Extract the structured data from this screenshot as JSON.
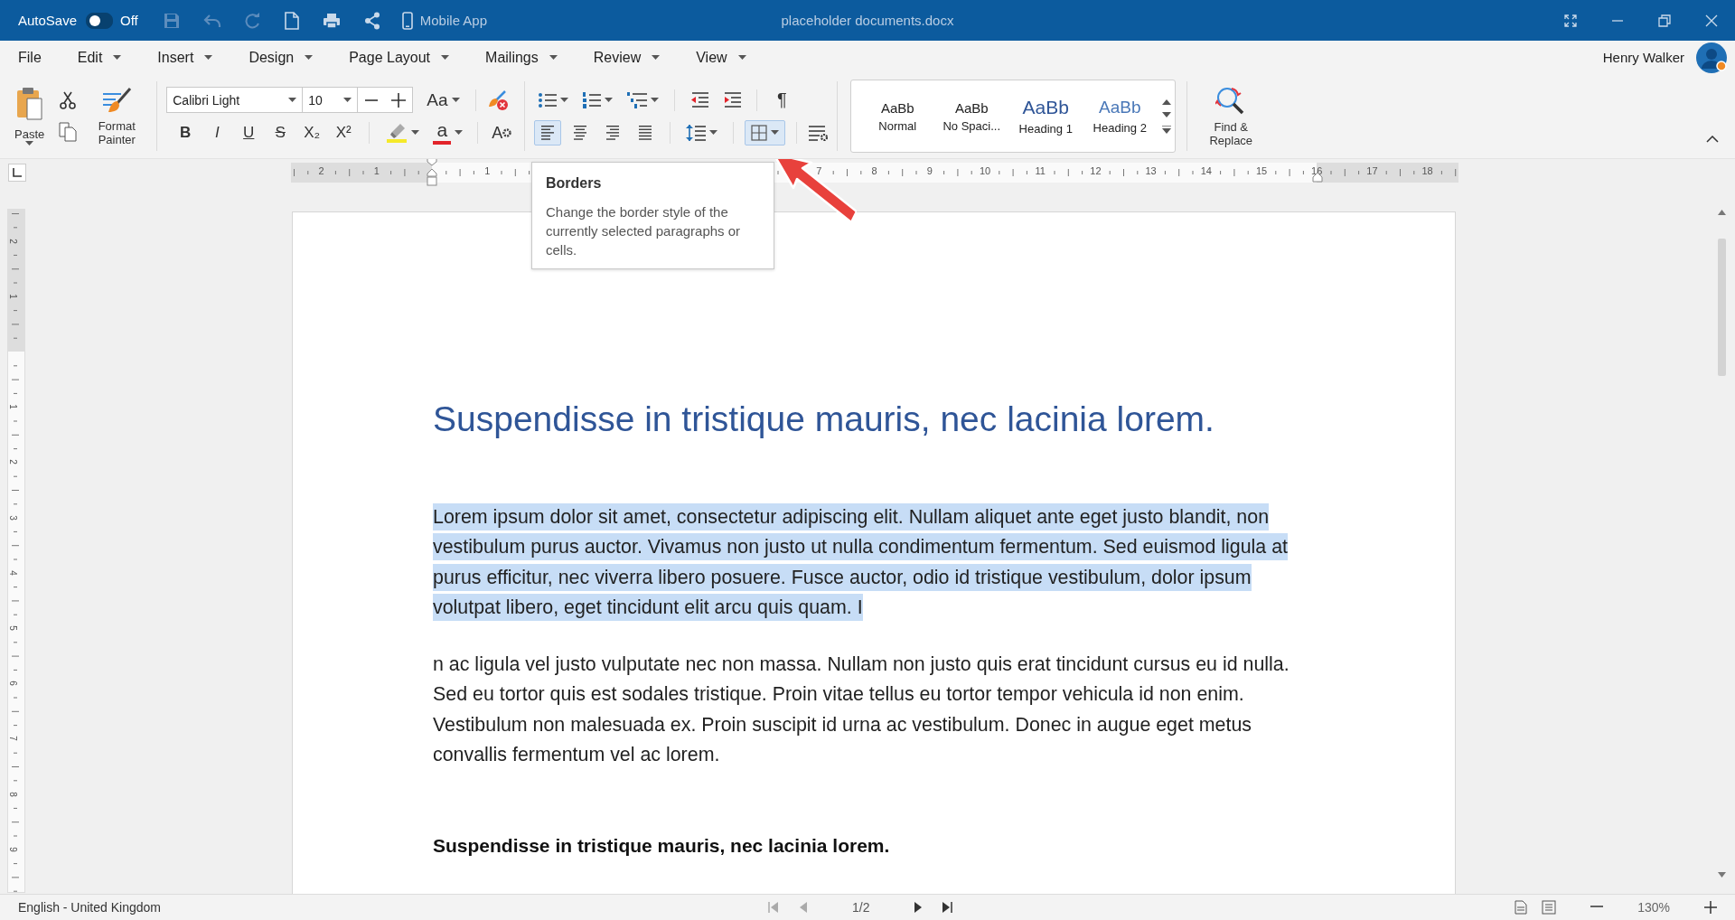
{
  "title_bar": {
    "autosave_label": "AutoSave",
    "autosave": {
      "on": false,
      "label": "Off"
    },
    "mobile_app": "Mobile App",
    "title": "placeholder documents.docx"
  },
  "menu": [
    {
      "label": "File",
      "has_menu": false
    },
    {
      "label": "Edit",
      "has_menu": true
    },
    {
      "label": "Insert",
      "has_menu": true
    },
    {
      "label": "Design",
      "has_menu": true
    },
    {
      "label": "Page Layout",
      "has_menu": true
    },
    {
      "label": "Mailings",
      "has_menu": true
    },
    {
      "label": "Review",
      "has_menu": true
    },
    {
      "label": "View",
      "has_menu": true
    }
  ],
  "user": {
    "name": "Henry Walker"
  },
  "ribbon": {
    "paste": "Paste",
    "format_painter": "Format Painter",
    "font_name": "Calibri Light",
    "font_size": "10",
    "case_label": "Aa",
    "font_color_label": "a",
    "effects_label": "A",
    "pilcrow": "¶",
    "format_buttons": [
      {
        "kind": "bold",
        "label": "B"
      },
      {
        "kind": "italic",
        "label": "I"
      },
      {
        "kind": "underline",
        "label": "U"
      },
      {
        "kind": "strike",
        "label": "S"
      },
      {
        "kind": "subscript",
        "label": "X₂"
      },
      {
        "kind": "superscript",
        "label": "X²"
      }
    ],
    "alignment": [
      {
        "kind": "left",
        "selected": true
      },
      {
        "kind": "center",
        "selected": false
      },
      {
        "kind": "right",
        "selected": false
      },
      {
        "kind": "justify",
        "selected": false
      }
    ],
    "borders": {
      "selected": true
    },
    "styles": [
      {
        "kind": "normal",
        "preview": "AaBb",
        "name": "Normal"
      },
      {
        "kind": "normal",
        "preview": "AaBb",
        "name": "No Spaci..."
      },
      {
        "kind": "heading1",
        "preview": "AaBb",
        "name": "Heading 1"
      },
      {
        "kind": "heading2",
        "preview": "AaBb",
        "name": "Heading 2"
      }
    ],
    "find_replace": "Find & Replace"
  },
  "ruler": {
    "labels": [
      "2",
      "1",
      "1",
      "7",
      "8",
      "9",
      "10",
      "11",
      "12",
      "13",
      "14",
      "15",
      "16",
      "17",
      "18"
    ],
    "vertical_labels": [
      "2",
      "1",
      "1",
      "2",
      "3",
      "4",
      "5",
      "6",
      "7",
      "8",
      "9"
    ]
  },
  "tooltip": {
    "title": "Borders",
    "text": "Change the border style of the currently selected paragraphs or cells."
  },
  "document": {
    "heading": "Suspendisse in tristique mauris, nec lacinia lorem.",
    "paragraphs": [
      {
        "text": "Lorem ipsum dolor sit amet, consectetur adipiscing elit. Nullam aliquet ante eget justo blandit, non vestibulum purus auctor. Vivamus non justo ut nulla condimentum fermentum. Sed euismod ligula at purus efficitur, nec viverra libero posuere. Fusce auctor, odio id tristique vestibulum, dolor ipsum volutpat libero, eget tincidunt elit arcu quis quam. I",
        "selected": true
      },
      {
        "text": "n ac ligula vel justo vulputate nec non massa. Nullam non justo quis erat tincidunt cursus eu id nulla. Sed eu tortor quis est sodales tristique. Proin vitae tellus eu tortor tempor vehicula id non enim. Vestibulum non malesuada ex. Proin suscipit id urna ac vestibulum. Donec in augue eget metus convallis fermentum vel ac lorem.",
        "selected": false
      }
    ],
    "subheading": "Suspendisse in tristique mauris, nec lacinia lorem."
  },
  "status_bar": {
    "language": "English - United Kingdom",
    "page": "1/2",
    "zoom": "130%"
  }
}
